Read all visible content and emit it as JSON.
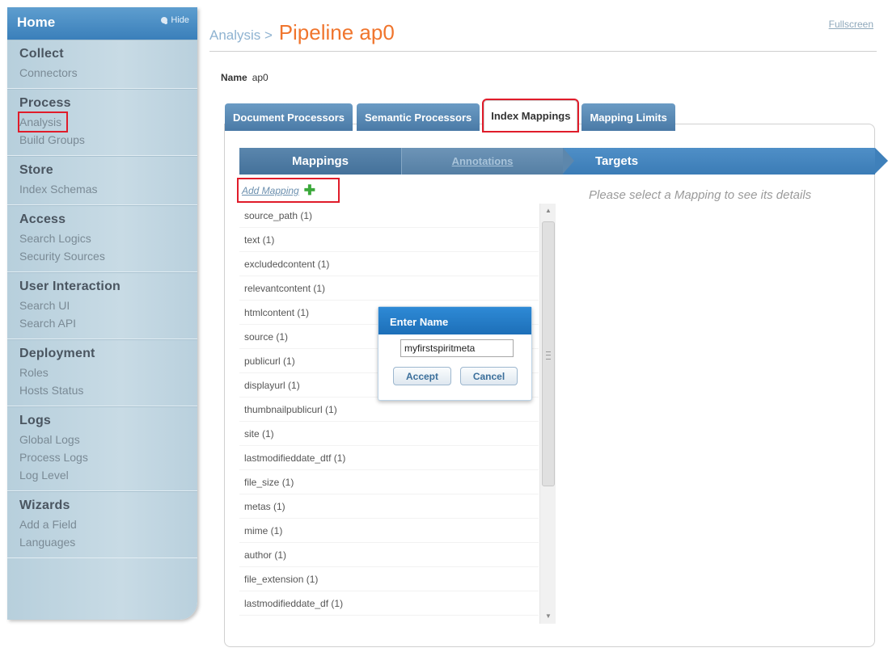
{
  "sidebar": {
    "home": "Home",
    "hide": "Hide",
    "sections": [
      {
        "title": "Collect",
        "items": [
          "Connectors"
        ]
      },
      {
        "title": "Process",
        "items": [
          "Analysis",
          "Build Groups"
        ]
      },
      {
        "title": "Store",
        "items": [
          "Index Schemas"
        ]
      },
      {
        "title": "Access",
        "items": [
          "Search Logics",
          "Security Sources"
        ]
      },
      {
        "title": "User Interaction",
        "items": [
          "Search UI",
          "Search API"
        ]
      },
      {
        "title": "Deployment",
        "items": [
          "Roles",
          "Hosts Status"
        ]
      },
      {
        "title": "Logs",
        "items": [
          "Global Logs",
          "Process Logs",
          "Log Level"
        ]
      },
      {
        "title": "Wizards",
        "items": [
          "Add a Field",
          "Languages"
        ]
      }
    ]
  },
  "header": {
    "crumb": "Analysis >",
    "page_title": "Pipeline ap0",
    "fullscreen": "Fullscreen"
  },
  "name_row": {
    "label": "Name",
    "value": "ap0"
  },
  "tabs": [
    "Document Processors",
    "Semantic Processors",
    "Index Mappings",
    "Mapping Limits"
  ],
  "steps": {
    "mappings": "Mappings",
    "annotations": "Annotations",
    "targets": "Targets"
  },
  "add_mapping": "Add Mapping",
  "mappings": [
    "source_path (1)",
    "text (1)",
    "excludedcontent (1)",
    "relevantcontent (1)",
    "htmlcontent (1)",
    "source (1)",
    "publicurl (1)",
    "displayurl (1)",
    "thumbnailpublicurl (1)",
    "site (1)",
    "lastmodifieddate_dtf (1)",
    "file_size (1)",
    "metas (1)",
    "mime (1)",
    "author (1)",
    "file_extension (1)",
    "lastmodifieddate_df (1)"
  ],
  "detail_message": "Please select a Mapping to see its details",
  "dialog": {
    "title": "Enter Name",
    "input_value": "myfirstspiritmeta",
    "accept": "Accept",
    "cancel": "Cancel"
  },
  "colors": {
    "accent": "#f0752d",
    "tab_blue": "#4a7aa6",
    "highlight": "#e01c2a"
  }
}
